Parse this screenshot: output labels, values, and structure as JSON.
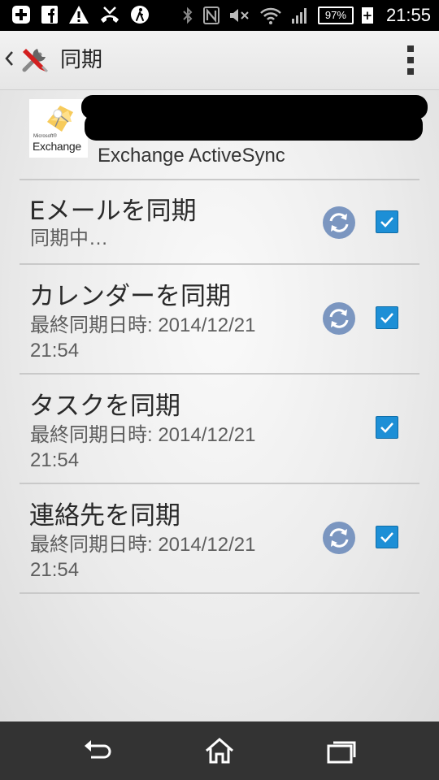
{
  "status_bar": {
    "time": "21:55",
    "battery_percent": "97%",
    "icons_left": [
      "plus-icon",
      "facebook-icon",
      "warning-icon",
      "missed-call-icon",
      "walking-icon"
    ],
    "icons_right": [
      "bluetooth-icon",
      "nfc-icon",
      "mute-icon",
      "wifi-icon",
      "signal-icon",
      "battery-icon"
    ]
  },
  "action_bar": {
    "title": "同期",
    "app_icon": "settings-tools-icon",
    "menu_icon": "overflow-menu-icon"
  },
  "account": {
    "logo_small_text": "Microsoft®",
    "logo_text": "Exchange",
    "type": "Exchange ActiveSync"
  },
  "sync_items": [
    {
      "title": "Eメールを同期",
      "subtitle": "同期中…",
      "sync_icon": true,
      "checked": true
    },
    {
      "title": "カレンダーを同期",
      "subtitle": "最終同期日時: 2014/12/21 21:54",
      "sync_icon": true,
      "checked": true
    },
    {
      "title": "タスクを同期",
      "subtitle": "最終同期日時: 2014/12/21 21:54",
      "sync_icon": false,
      "checked": true
    },
    {
      "title": "連絡先を同期",
      "subtitle": "最終同期日時: 2014/12/21 21:54",
      "sync_icon": true,
      "checked": true
    }
  ],
  "nav_bar": {
    "buttons": [
      "back-icon",
      "home-icon",
      "recent-apps-icon"
    ]
  },
  "colors": {
    "accent": "#1d8fd6",
    "sync_icon": "#7b96c0",
    "nav_bg": "#333333"
  }
}
